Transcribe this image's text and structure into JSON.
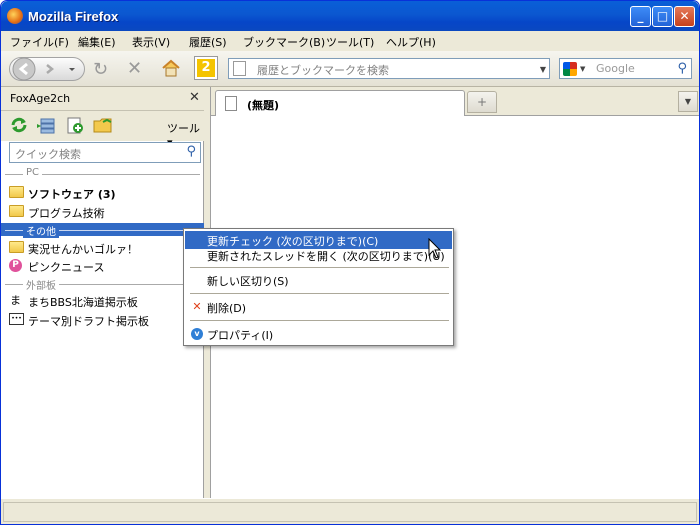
{
  "window": {
    "title": "Mozilla Firefox"
  },
  "menubar": [
    "ファイル(F)",
    "編集(E)",
    "表示(V)",
    "履歴(S)",
    "ブックマーク(B)",
    "ツール(T)",
    "ヘルプ(H)"
  ],
  "navbar": {
    "url_placeholder": "履歴とブックマークを検索",
    "search_placeholder": "Google",
    "badge": "2"
  },
  "sidebar": {
    "title": "FoxAge2ch",
    "tools_label": "ツール",
    "search_placeholder": "クイック検索",
    "tree": {
      "sep_pc": "PC",
      "software": "ソフトウェア (3)",
      "programming": "プログラム技術",
      "sep_other": "その他",
      "jikkyou": "実況せんかいゴルァ！",
      "pink_news": "ピンクニュース",
      "sep_external": "外部板",
      "machi_bbs": "まちBBS北海道掲示板",
      "theme_draft": "テーマ別ドラフト掲示板"
    }
  },
  "tabs": {
    "tab_title": "(無題)"
  },
  "context_menu": {
    "check_updates": "更新チェック (次の区切りまで)(C)",
    "open_updated": "更新されたスレッドを開く (次の区切りまで)(U)",
    "new_separator": "新しい区切り(S)",
    "delete": "削除(D)",
    "properties": "プロパティ(I)"
  },
  "colors": {
    "titlebar": "#0a5fd8",
    "selection": "#316ac5"
  }
}
